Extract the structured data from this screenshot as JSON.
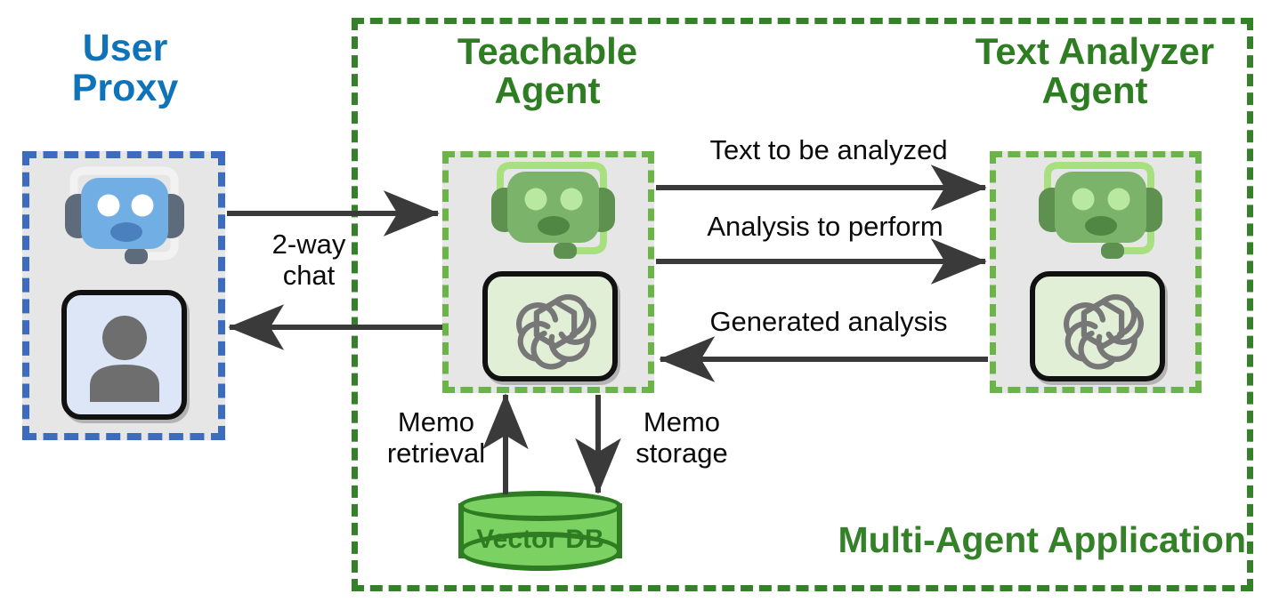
{
  "diagram": {
    "title": "Multi-Agent Application with Teachable Agent and Text Analyzer Agent"
  },
  "nodes": {
    "user_proxy": {
      "title": "User\nProxy",
      "title_color": "#0E73B9",
      "border_color": "#3B6CC0",
      "bg_color": "#E6E6E6",
      "robot_icon": "blue-robot-headset-icon",
      "panel_icon": "user-avatar-icon"
    },
    "teachable_agent": {
      "title": "Teachable\nAgent",
      "title_color": "#2E7D22",
      "border_color": "#6BB548",
      "bg_color": "#E6E6E6",
      "robot_icon": "green-robot-headset-icon",
      "panel_icon": "openai-logo-icon"
    },
    "text_analyzer_agent": {
      "title": "Text Analyzer\nAgent",
      "title_color": "#2E7D22",
      "border_color": "#6BB548",
      "bg_color": "#E6E6E6",
      "robot_icon": "green-robot-headset-icon",
      "panel_icon": "openai-logo-icon"
    },
    "vector_db": {
      "label": "Vector DB",
      "fill_color": "#7BD161",
      "border_color": "#2E7D22"
    }
  },
  "container": {
    "label": "Multi-Agent Application",
    "border_color": "#34812A",
    "border_style": "dashed"
  },
  "edges": {
    "two_way_chat": "2-way\nchat",
    "text_to_be_analyzed": "Text to be analyzed",
    "analysis_to_perform": "Analysis to perform",
    "generated_analysis": "Generated analysis",
    "memo_retrieval": "Memo\nretrieval",
    "memo_storage": "Memo\nstorage"
  },
  "colors": {
    "arrow": "#3A3A3A",
    "blue_accent": "#0E73B9",
    "green_accent": "#2E7D22",
    "light_green_dash": "#6BB548",
    "card_bg": "#E6E6E6"
  }
}
